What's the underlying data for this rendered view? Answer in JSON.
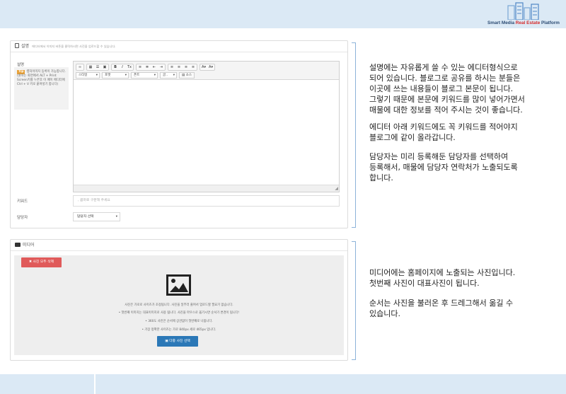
{
  "brand": {
    "logo_text_before": "Smart Media ",
    "logo_text_accent": "Real Estate",
    "logo_text_after": " Platform",
    "accent_color": "#d62a2a"
  },
  "description_panel": {
    "header_title": "설명",
    "header_hint": "에디터에서 이미지 버튼을 클릭하시면 사진을 업로드할 수 있습니다.",
    "description_label": "설명",
    "help_badge": "Tip",
    "help_text": "캡처이미지 등록이 가능합니다. (원하는 화면에서 ALT + Print Screen키를 누른후 이 페이 에디터에 Ctrl + V 키로 붙여넣기 합니다)",
    "toolbar": {
      "style_select": "스타일",
      "format_select": "포맷",
      "font_select": "폰트",
      "size_select": "글..",
      "source_button": "소스"
    },
    "keyword_label": "키워드",
    "keyword_placeholder": ", 콤마로 구분해 주세요",
    "manager_label": "담당자",
    "manager_select_value": "담당자 선택"
  },
  "media_panel": {
    "header_title": "미디어",
    "delete_all_button": "✖ 사진 모두 삭제",
    "info_lines": [
      "사진은 가로로 사이즈가 조정됩니다. 사진을 일부러 줄여서 업로드할 필요가 없습니다.",
      "• 첫번째 이미지는 대표이미지로 사용 됩니다. 사진을 마우스로 옮기시면 순서가 변경이 됩니다!",
      "• 360도 사진은 순서에 상관없이 첫번째로 나옵니다.",
      "• 가장 정확한 사이즈는 가로 840px 세로 465px 입니다."
    ],
    "select_photos_button": "다중 사진 선택"
  },
  "explanations": {
    "editor_text": [
      "설명에는 자유롭게 쓸 수 있는 에디터형식으로",
      "되어 있습니다. 블로그로 공유를 하시는 분들은",
      "이곳에 쓰는 내용들이 블로그 본문이 됩니다.",
      "그렇기 때문에 본문에 키워드를 많이 넣어가면서",
      "매물에 대한 정보를 적어 주시는 것이 좋습니다."
    ],
    "keyword_text": [
      "에디터 아래 키워드에도 꼭 키워드를 적어야지",
      "블로그에 같이 올라갑니다."
    ],
    "manager_text": [
      "담당자는 미리 등록해둔 담당자를 선택하여",
      "등록해서, 매물에 담당자 연락처가 노출되도록",
      "합니다."
    ],
    "media_text": [
      "미디어에는 홈페이지에 노출되는 사진입니다.",
      "첫번째 사진이 대표사진이 됩니다."
    ],
    "order_text": [
      "순서는 사진을 불러온 후 드레그해서 옮길 수",
      "있습니다."
    ]
  },
  "colors": {
    "band": "#dbe9f5",
    "delete_button": "#e05a5a",
    "select_button": "#2b78b7",
    "help_badge": "#e8a23a"
  },
  "icons": [
    "building-logo-icon",
    "document-icon",
    "camera-icon",
    "image-placeholder-icon",
    "resize-grip-icon"
  ]
}
